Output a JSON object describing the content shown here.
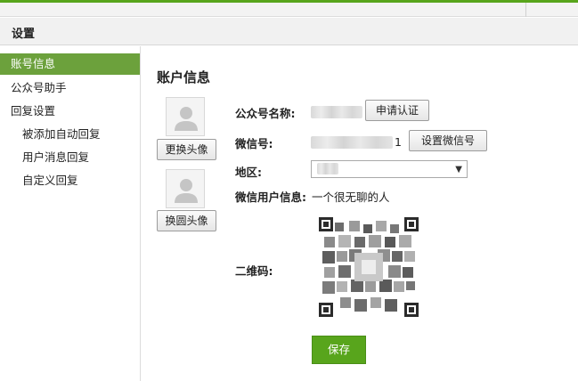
{
  "header": {
    "title": "设置"
  },
  "sidebar": {
    "items": [
      {
        "label": "账号信息"
      },
      {
        "label": "公众号助手"
      },
      {
        "label": "回复设置"
      },
      {
        "label": "被添加自动回复"
      },
      {
        "label": "用户消息回复"
      },
      {
        "label": "自定义回复"
      }
    ]
  },
  "main": {
    "title": "账户信息",
    "avatar_buttons": {
      "change_avatar": "更换头像",
      "change_round_avatar": "换圆头像"
    },
    "fields": {
      "public_name_label": "公众号名称:",
      "apply_verify_button": "申请认证",
      "wechat_id_label": "微信号:",
      "wechat_id_suffix": "1",
      "set_wechat_id_button": "设置微信号",
      "region_label": "地区:",
      "region_arrow": "▼",
      "user_info_label": "微信用户信息:",
      "user_info_value": "一个很无聊的人",
      "qrcode_label": "二维码:"
    },
    "save_button": "保存"
  },
  "colors": {
    "accent": "#58a51c",
    "sidebar_active": "#6ca13c"
  },
  "icons": {
    "avatar_placeholder": "user-silhouette-icon",
    "dropdown": "chevron-down-icon"
  }
}
